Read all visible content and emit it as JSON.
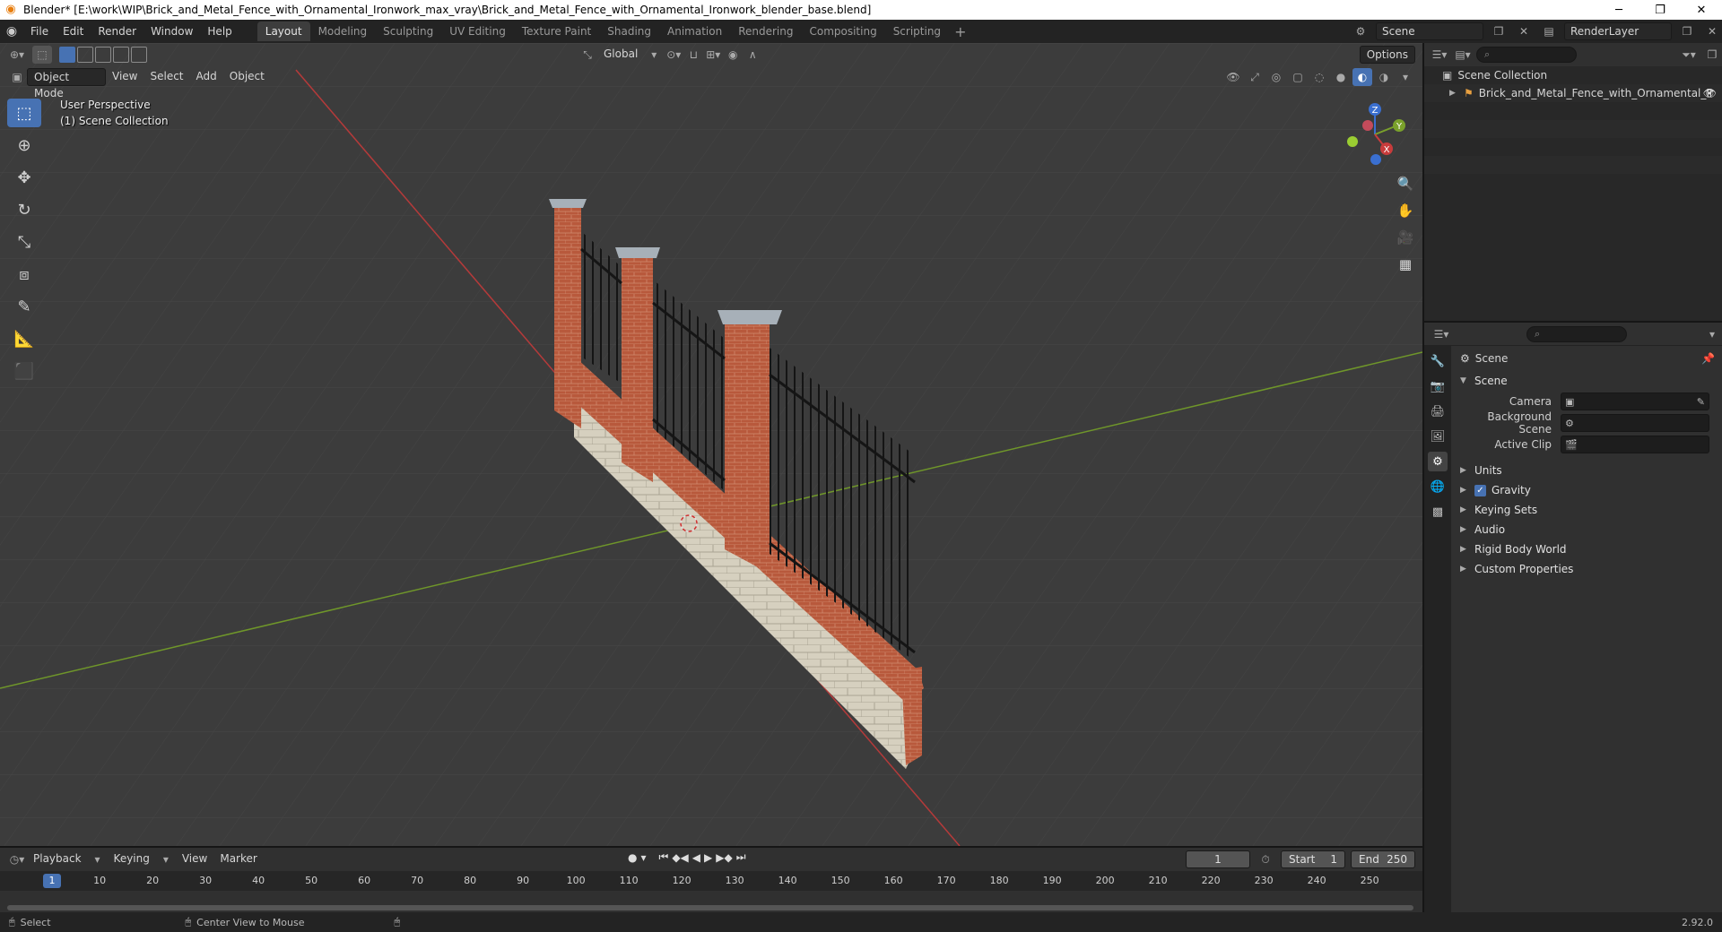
{
  "window": {
    "title": "Blender* [E:\\work\\WIP\\Brick_and_Metal_Fence_with_Ornamental_Ironwork_max_vray\\Brick_and_Metal_Fence_with_Ornamental_Ironwork_blender_base.blend]",
    "minimize": "─",
    "maximize": "❐",
    "close": "✕"
  },
  "menu": {
    "file": "File",
    "edit": "Edit",
    "render": "Render",
    "window": "Window",
    "help": "Help"
  },
  "workspaces": [
    "Layout",
    "Modeling",
    "Sculpting",
    "UV Editing",
    "Texture Paint",
    "Shading",
    "Animation",
    "Rendering",
    "Compositing",
    "Scripting"
  ],
  "top_right": {
    "scene": "Scene",
    "view_layer": "RenderLayer"
  },
  "viewport": {
    "mode": "Object Mode",
    "menus": {
      "view": "View",
      "select": "Select",
      "add": "Add",
      "object": "Object"
    },
    "transform_orientation": "Global",
    "options": "Options",
    "perspective_label": "User Perspective",
    "collection_label": "(1) Scene Collection",
    "gizmo": {
      "x": "X",
      "y": "Y",
      "z": "Z"
    }
  },
  "outliner": {
    "root": "Scene Collection",
    "items": [
      {
        "label": "Brick_and_Metal_Fence_with_Ornamental_Ir"
      }
    ]
  },
  "properties": {
    "context": "Scene",
    "panel": "Scene",
    "fields": {
      "camera": "Camera",
      "background_scene": "Background Scene",
      "active_clip": "Active Clip"
    },
    "subpanels": {
      "units": "Units",
      "gravity": "Gravity",
      "keying_sets": "Keying Sets",
      "audio": "Audio",
      "rigid_body_world": "Rigid Body World",
      "custom_properties": "Custom Properties"
    }
  },
  "timeline": {
    "menus": {
      "playback": "Playback",
      "keying": "Keying",
      "view": "View",
      "marker": "Marker"
    },
    "current_frame": "1",
    "start_label": "Start",
    "start": "1",
    "end_label": "End",
    "end": "250",
    "ruler": [
      {
        "label": "1",
        "frame": 1
      },
      {
        "label": "10",
        "frame": 10
      },
      {
        "label": "20",
        "frame": 20
      },
      {
        "label": "30",
        "frame": 30
      },
      {
        "label": "40",
        "frame": 40
      },
      {
        "label": "50",
        "frame": 50
      },
      {
        "label": "60",
        "frame": 60
      },
      {
        "label": "70",
        "frame": 70
      },
      {
        "label": "80",
        "frame": 80
      },
      {
        "label": "90",
        "frame": 90
      },
      {
        "label": "100",
        "frame": 100
      },
      {
        "label": "110",
        "frame": 110
      },
      {
        "label": "120",
        "frame": 120
      },
      {
        "label": "130",
        "frame": 130
      },
      {
        "label": "140",
        "frame": 140
      },
      {
        "label": "150",
        "frame": 150
      },
      {
        "label": "160",
        "frame": 160
      },
      {
        "label": "170",
        "frame": 170
      },
      {
        "label": "180",
        "frame": 180
      },
      {
        "label": "190",
        "frame": 190
      },
      {
        "label": "200",
        "frame": 200
      },
      {
        "label": "210",
        "frame": 210
      },
      {
        "label": "220",
        "frame": 220
      },
      {
        "label": "230",
        "frame": 230
      },
      {
        "label": "240",
        "frame": 240
      },
      {
        "label": "250",
        "frame": 250
      }
    ]
  },
  "status": {
    "select": "Select",
    "center_view": "Center View to Mouse",
    "version": "2.92.0"
  },
  "colors": {
    "accent": "#4772b3",
    "x_axis": "#c83c3c",
    "y_axis": "#7aa12b",
    "brick": "#b4573b",
    "stone": "#d8d2c2",
    "cap": "#a5aeb6",
    "iron": "#1e1e1e"
  }
}
